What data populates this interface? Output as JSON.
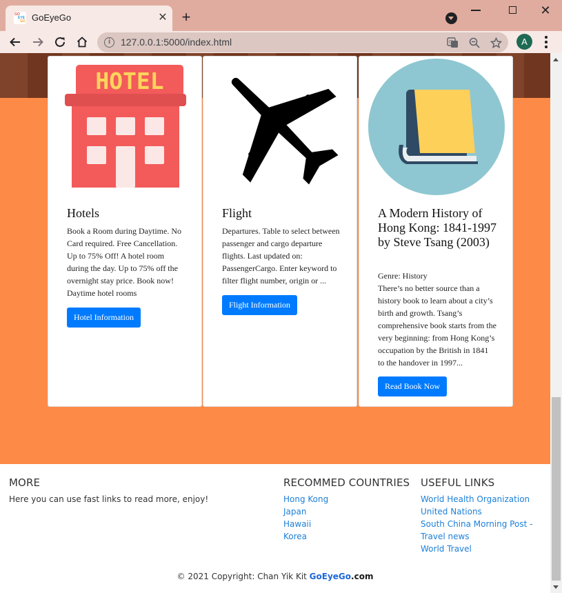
{
  "browser": {
    "tab_title": "GoEyeGo",
    "favicon_text": "GO EYE GO",
    "url": "127.0.0.1:5000/index.html",
    "profile_initial": "A"
  },
  "cards": [
    {
      "title": "Hotels",
      "image_text": "HOTEL",
      "text": "Book a Room during Daytime. No Card required. Free Cancellation. Up to 75% Off! A hotel room during the day. Up to 75% off the overnight stay price. Book now! Daytime hotel rooms",
      "button": "Hotel Information"
    },
    {
      "title": "Flight",
      "text": "Departures. Table to select between passenger and cargo departure flights. Last updated on: PassengerCargo. Enter keyword to filter flight number, origin or ...",
      "button": "Flight Information"
    },
    {
      "title": "A Modern History of Hong Kong: 1841-1997 by Steve Tsang (2003)",
      "genre": "Genre: History",
      "text": "There’s no better source than a history book to learn about a city’s birth and growth. Tsang’s comprehensive book starts from the very beginning: from Hong Kong’s occupation by the British in 1841 to the handover in 1997...",
      "button": "Read Book Now"
    }
  ],
  "footer": {
    "more_heading": "MORE",
    "more_text": "Here you can use fast links to read more, enjoy!",
    "countries_heading": "RECOMMED COUNTRIES",
    "countries": [
      "Hong Kong",
      "Japan",
      "Hawaii",
      "Korea"
    ],
    "links_heading": "USEFUL LINKS",
    "links": [
      "World Health Organization",
      "United Nations",
      "South China Morning Post - Travel news",
      "World Travel"
    ],
    "copyright_prefix": "© 2021 Copyright: Chan Yik Kit ",
    "copyright_brand": "GoEyeGo",
    "copyright_suffix": ".com"
  },
  "colors": {
    "page_band": "#fe8a48",
    "button": "#007bff",
    "link": "#1d7fd8",
    "chrome_titlebar": "#e0ac9f"
  }
}
